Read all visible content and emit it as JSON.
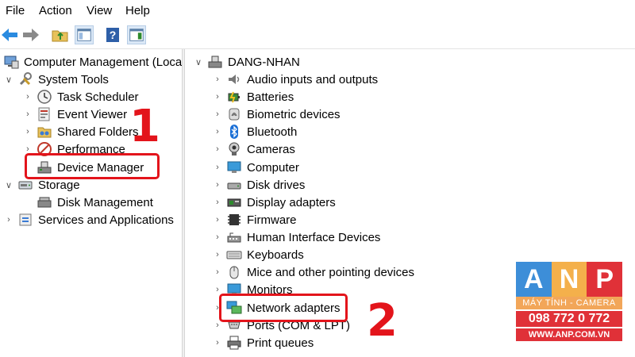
{
  "menu": [
    "File",
    "Action",
    "View",
    "Help"
  ],
  "left_tree": {
    "root": "Computer Management (Local)",
    "items": [
      {
        "label": "System Tools",
        "level": 1,
        "expand": "open",
        "icon": "tools-icon"
      },
      {
        "label": "Task Scheduler",
        "level": 2,
        "expand": "closed",
        "icon": "clock-icon"
      },
      {
        "label": "Event Viewer",
        "level": 2,
        "expand": "closed",
        "icon": "event-viewer-icon"
      },
      {
        "label": "Shared Folders",
        "level": 2,
        "expand": "closed",
        "icon": "shared-folder-icon"
      },
      {
        "label": "Performance",
        "level": 2,
        "expand": "closed",
        "icon": "performance-icon"
      },
      {
        "label": "Device Manager",
        "level": 2,
        "expand": "none",
        "icon": "device-manager-icon"
      },
      {
        "label": "Storage",
        "level": 1,
        "expand": "open",
        "icon": "storage-icon"
      },
      {
        "label": "Disk Management",
        "level": 2,
        "expand": "none",
        "icon": "disk-icon"
      },
      {
        "label": "Services and Applications",
        "level": 1,
        "expand": "closed",
        "icon": "services-icon"
      }
    ]
  },
  "device_tree": {
    "computer": "DANG-NHAN",
    "categories": [
      {
        "label": "Audio inputs and outputs",
        "icon": "speaker-icon"
      },
      {
        "label": "Batteries",
        "icon": "battery-icon"
      },
      {
        "label": "Biometric devices",
        "icon": "fingerprint-icon"
      },
      {
        "label": "Bluetooth",
        "icon": "bluetooth-icon"
      },
      {
        "label": "Cameras",
        "icon": "camera-icon"
      },
      {
        "label": "Computer",
        "icon": "monitor-icon"
      },
      {
        "label": "Disk drives",
        "icon": "disk-drive-icon"
      },
      {
        "label": "Display adapters",
        "icon": "display-adapter-icon"
      },
      {
        "label": "Firmware",
        "icon": "firmware-icon"
      },
      {
        "label": "Human Interface Devices",
        "icon": "hid-icon"
      },
      {
        "label": "Keyboards",
        "icon": "keyboard-icon"
      },
      {
        "label": "Mice and other pointing devices",
        "icon": "mouse-icon"
      },
      {
        "label": "Monitors",
        "icon": "monitor-icon"
      },
      {
        "label": "Network adapters",
        "icon": "network-icon"
      },
      {
        "label": "Ports (COM & LPT)",
        "icon": "port-icon"
      },
      {
        "label": "Print queues",
        "icon": "printer-icon"
      }
    ]
  },
  "annotations": {
    "step1": "1",
    "step2": "2"
  },
  "watermark": {
    "letters": [
      "A",
      "N",
      "P"
    ],
    "tagline": "MÁY TÍNH - CAMERA",
    "phone": "098 772 0 772",
    "website": "WWW.ANP.COM.VN"
  },
  "colors": {
    "annotation_red": "#e3141b",
    "logo_blue": "#3d8ed8",
    "logo_orange": "#f4b04b",
    "logo_red": "#e03138"
  }
}
